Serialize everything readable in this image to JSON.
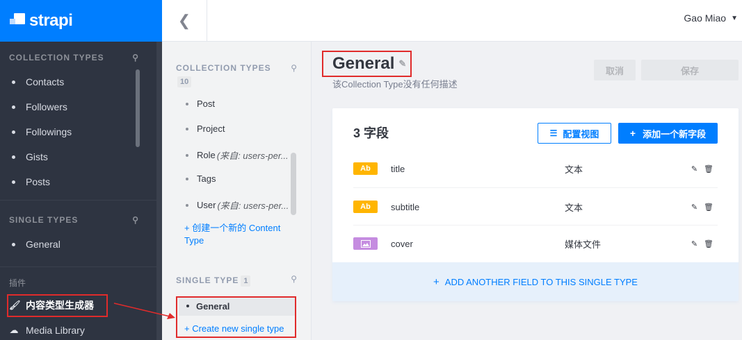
{
  "brand": {
    "name": "strapi"
  },
  "sidebar": {
    "collection_title": "COLLECTION TYPES",
    "collection_items": [
      "Contacts",
      "Followers",
      "Followings",
      "Gists",
      "Posts"
    ],
    "single_title": "SINGLE TYPES",
    "single_items": [
      "General"
    ],
    "plugins_title": "插件",
    "plugins": [
      {
        "label": "内容类型生成器",
        "icon": "paintbrush-icon"
      },
      {
        "label": "Media Library",
        "icon": "cloud-icon"
      }
    ]
  },
  "topbar": {
    "back_icon": "chevron-left-icon",
    "user": "Gao Miao"
  },
  "panel": {
    "collection_title": "COLLECTION TYPES",
    "collection_count": "10",
    "collection_items": [
      {
        "name": "Post",
        "from": ""
      },
      {
        "name": "Project",
        "from": ""
      },
      {
        "name": "Role",
        "from": "(来自: users-per..."
      },
      {
        "name": "Tags",
        "from": ""
      },
      {
        "name": "User",
        "from": "(来自: users-per..."
      }
    ],
    "create_collection_link": "+ 创建一个新的 Content Type",
    "single_title": "SINGLE TYPE",
    "single_count": "1",
    "single_items": [
      "General"
    ],
    "create_single_link": "+ Create new single type"
  },
  "main": {
    "title": "General",
    "description": "该Collection Type没有任何描述",
    "cancel_label": "取消",
    "save_label": "保存",
    "fields_count_label": "3 字段",
    "configure_label": "配置视图",
    "add_field_label": "添加一个新字段",
    "fields": [
      {
        "badge": "Ab",
        "name": "title",
        "type": "文本",
        "kind": "text"
      },
      {
        "badge": "Ab",
        "name": "subtitle",
        "type": "文本",
        "kind": "text"
      },
      {
        "badge": "",
        "name": "cover",
        "type": "媒体文件",
        "kind": "media"
      }
    ],
    "add_another_label": "ADD ANOTHER FIELD TO THIS SINGLE TYPE"
  },
  "colors": {
    "accent": "#007eff",
    "sidebar_bg": "#2e3441",
    "highlight": "#e02b2b"
  }
}
